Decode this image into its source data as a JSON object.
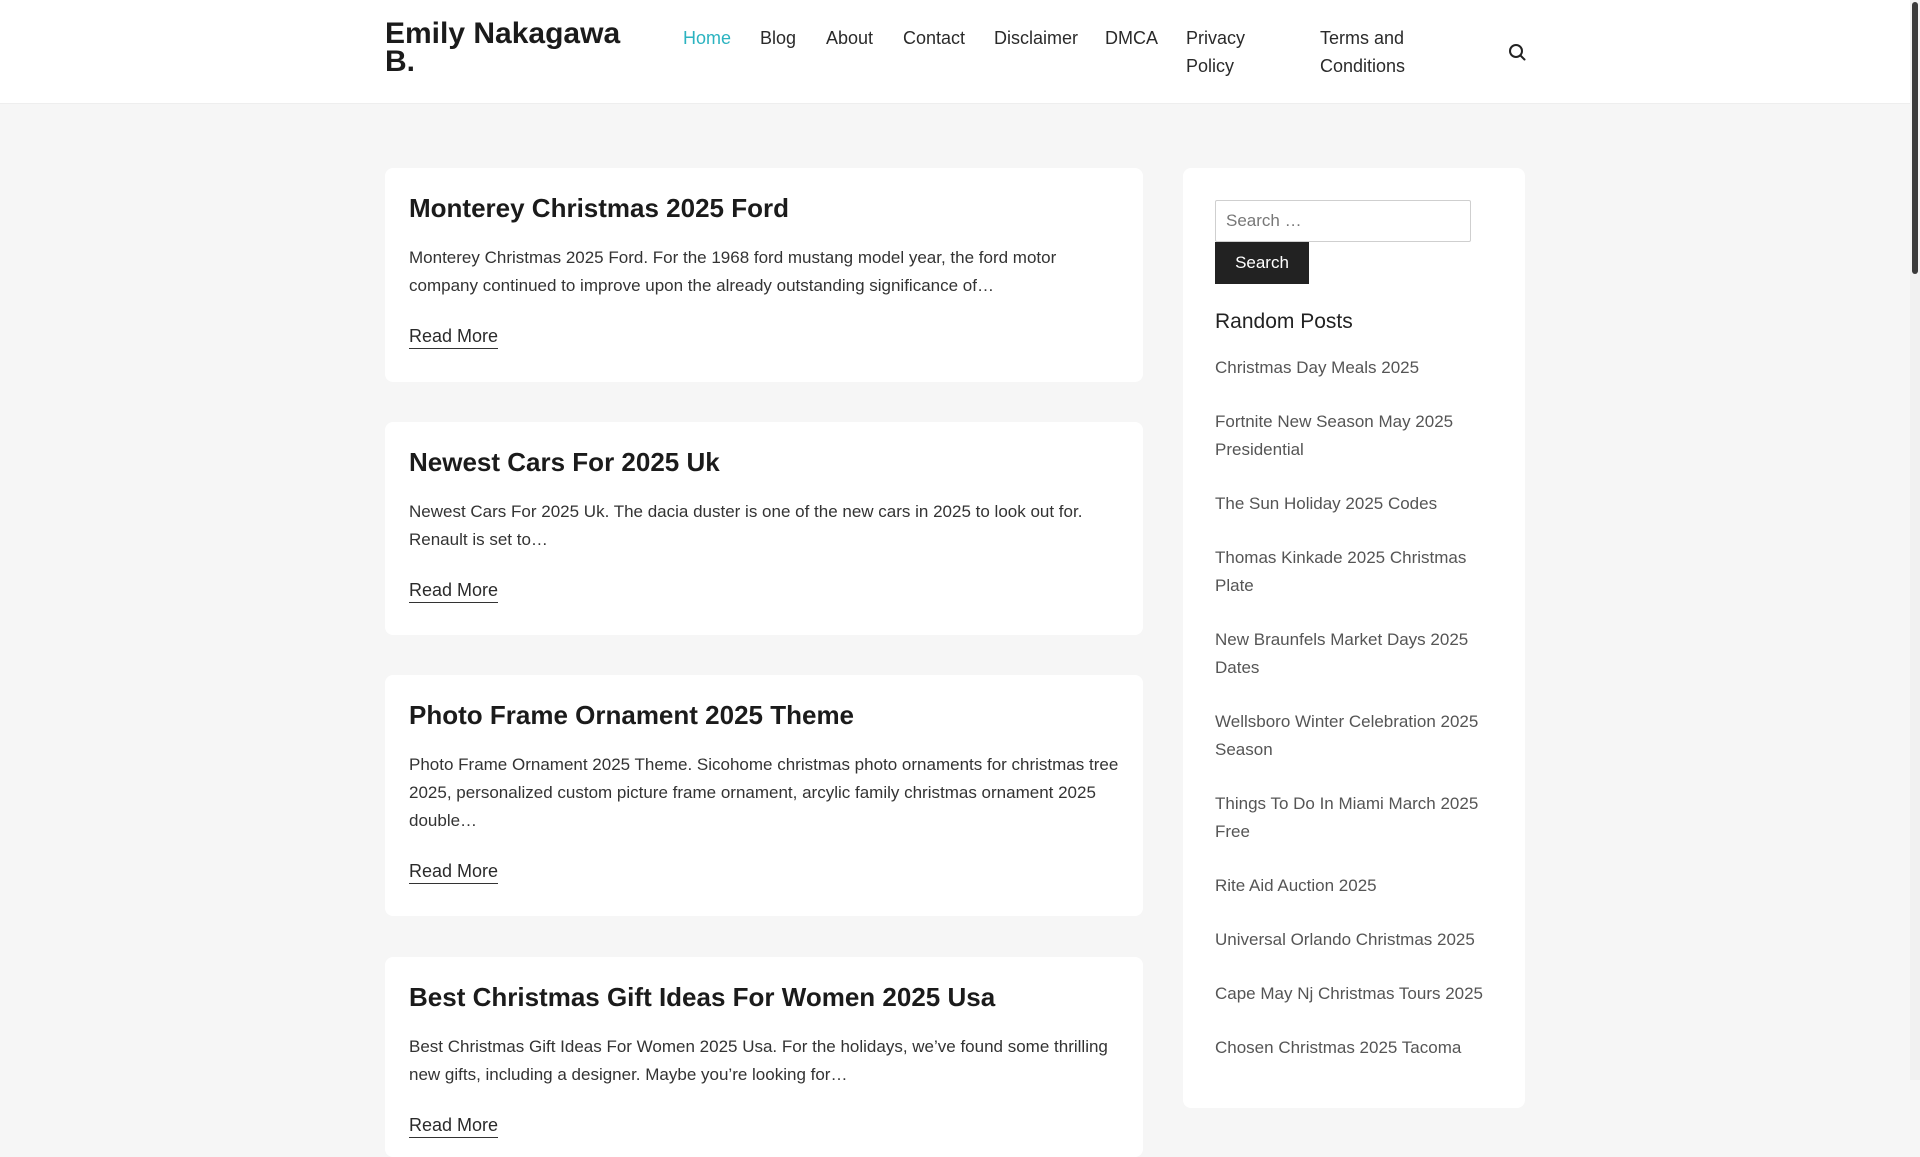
{
  "site": {
    "title": "Emily Nakagawa B."
  },
  "nav": {
    "items": [
      {
        "label": "Home"
      },
      {
        "label": "Blog"
      },
      {
        "label": "About"
      },
      {
        "label": "Contact"
      },
      {
        "label": "Disclaimer"
      },
      {
        "label": "DMCA"
      },
      {
        "label": "Privacy Policy"
      },
      {
        "label": "Terms and Conditions"
      }
    ],
    "search_icon": "search-icon"
  },
  "posts": [
    {
      "title": "Monterey Christmas 2025 Ford",
      "excerpt": "Monterey Christmas 2025 Ford. For the 1968 ford mustang model year, the ford motor company continued to improve upon the already outstanding significance of…",
      "read_more": "Read More"
    },
    {
      "title": "Newest Cars For 2025 Uk",
      "excerpt": "Newest Cars For 2025 Uk. The dacia duster is one of the new cars in 2025 to look out for. Renault is set to…",
      "read_more": "Read More"
    },
    {
      "title": "Photo Frame Ornament 2025 Theme",
      "excerpt": "Photo Frame Ornament 2025 Theme. Sicohome christmas photo ornaments for christmas tree 2025, personalized custom picture frame ornament, arcylic family christmas ornament 2025 double…",
      "read_more": "Read More"
    },
    {
      "title": "Best Christmas Gift Ideas For Women 2025 Usa",
      "excerpt": "Best Christmas Gift Ideas For Women 2025 Usa. For the holidays, we’ve found some thrilling new gifts, including a designer. Maybe you’re looking for…",
      "read_more": "Read More"
    }
  ],
  "sidebar": {
    "search": {
      "placeholder": "Search …",
      "value": "",
      "button_label": "Search"
    },
    "random_posts": {
      "title": "Random Posts",
      "items": [
        "Christmas Day Meals 2025",
        "Fortnite New Season May 2025 Presidential",
        "The Sun Holiday 2025 Codes",
        "Thomas Kinkade 2025 Christmas Plate",
        "New Braunfels Market Days 2025 Dates",
        "Wellsboro Winter Celebration 2025 Season",
        "Things To Do In Miami March 2025 Free",
        "Rite Aid Auction 2025",
        "Universal Orlando Christmas 2025",
        "Cape May Nj Christmas Tours 2025",
        "Chosen Christmas 2025 Tacoma"
      ]
    }
  },
  "colors": {
    "accent": "#2bb3c0",
    "page_background": "#f6f6f6",
    "button": "#222222"
  }
}
